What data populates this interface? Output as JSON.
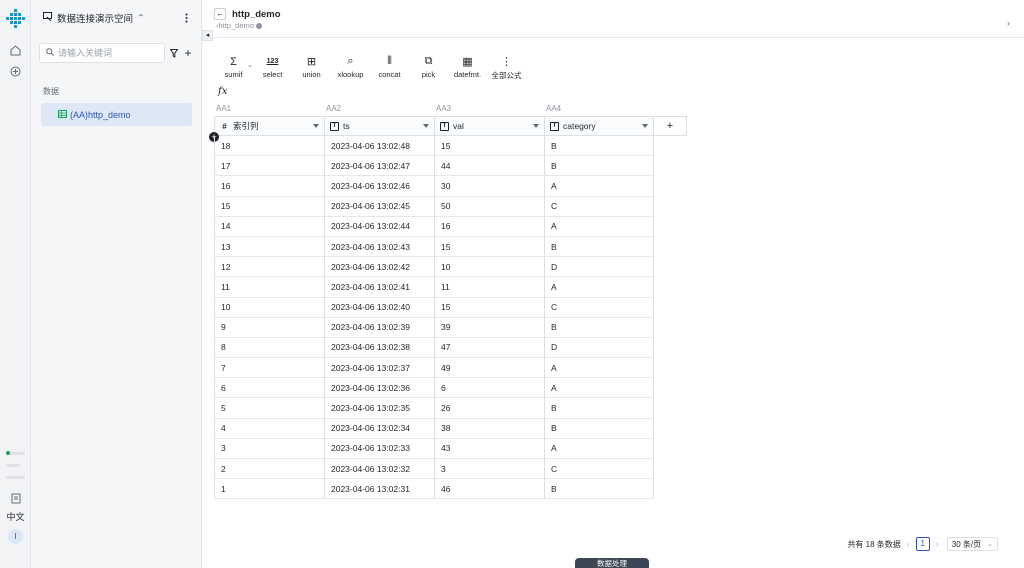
{
  "rail": {
    "logo_icon": "app-logo-icon",
    "language": "中文",
    "avatar_initial": "I"
  },
  "sidebar": {
    "workspace_name": "数据连接演示空间",
    "search_placeholder": "请输入关键词",
    "add_label": "+",
    "section_label": "数据",
    "items": [
      {
        "label": "(AA)http_demo",
        "selected": true
      }
    ]
  },
  "header": {
    "back_label": "←",
    "title": "http_demo",
    "breadcrumb": "http_demo",
    "next_label": "›",
    "collapse_label": "◂"
  },
  "toolbar": {
    "tools": [
      {
        "label": "sumif",
        "icon": "sigma-icon",
        "glyph": "Σ",
        "has_caret": true
      },
      {
        "label": "select",
        "icon": "select-123-icon",
        "glyph": "123"
      },
      {
        "label": "union",
        "icon": "union-icon",
        "glyph": "⊞"
      },
      {
        "label": "xlookup",
        "icon": "search-icon",
        "glyph": "⌕"
      },
      {
        "label": "concat",
        "icon": "concat-icon",
        "glyph": "⦀"
      },
      {
        "label": "pick",
        "icon": "pick-icon",
        "glyph": "⧉"
      },
      {
        "label": "datefmt.",
        "icon": "calendar-icon",
        "glyph": "▦"
      },
      {
        "label": "全部公式",
        "icon": "more-icon",
        "glyph": "⋮"
      }
    ],
    "fx_label": "fx"
  },
  "grid": {
    "column_codes": [
      "AA1",
      "AA2",
      "AA3",
      "AA4"
    ],
    "columns": [
      {
        "name": "索引列",
        "type_icon": "#"
      },
      {
        "name": "ts",
        "type_icon": "T"
      },
      {
        "name": "val",
        "type_icon": "T"
      },
      {
        "name": "category",
        "type_icon": "T"
      }
    ],
    "add_column_label": "+",
    "add_row_label": "+",
    "rows": [
      [
        "18",
        "2023-04-06 13:02:48",
        "15",
        "B"
      ],
      [
        "17",
        "2023-04-06 13:02:47",
        "44",
        "B"
      ],
      [
        "16",
        "2023-04-06 13:02:46",
        "30",
        "A"
      ],
      [
        "15",
        "2023-04-06 13:02:45",
        "50",
        "C"
      ],
      [
        "14",
        "2023-04-06 13:02:44",
        "16",
        "A"
      ],
      [
        "13",
        "2023-04-06 13:02:43",
        "15",
        "B"
      ],
      [
        "12",
        "2023-04-06 13:02:42",
        "10",
        "D"
      ],
      [
        "11",
        "2023-04-06 13:02:41",
        "11",
        "A"
      ],
      [
        "10",
        "2023-04-06 13:02:40",
        "15",
        "C"
      ],
      [
        "9",
        "2023-04-06 13:02:39",
        "39",
        "B"
      ],
      [
        "8",
        "2023-04-06 13:02:38",
        "47",
        "D"
      ],
      [
        "7",
        "2023-04-06 13:02:37",
        "49",
        "A"
      ],
      [
        "6",
        "2023-04-06 13:02:36",
        "6",
        "A"
      ],
      [
        "5",
        "2023-04-06 13:02:35",
        "26",
        "B"
      ],
      [
        "4",
        "2023-04-06 13:02:34",
        "38",
        "B"
      ],
      [
        "3",
        "2023-04-06 13:02:33",
        "43",
        "A"
      ],
      [
        "2",
        "2023-04-06 13:02:32",
        "3",
        "C"
      ],
      [
        "1",
        "2023-04-06 13:02:31",
        "46",
        "B"
      ]
    ]
  },
  "pagination": {
    "total_text": "共有 18 条数据",
    "prev_label": "‹",
    "current_page": "1",
    "next_label": "›",
    "page_size": "30 条/页"
  },
  "bottom_tab": {
    "label": "数据处理"
  },
  "colors": {
    "accent": "#2f54b7",
    "selected_bg": "#dde7f5",
    "status_green": "#1aa35c"
  }
}
